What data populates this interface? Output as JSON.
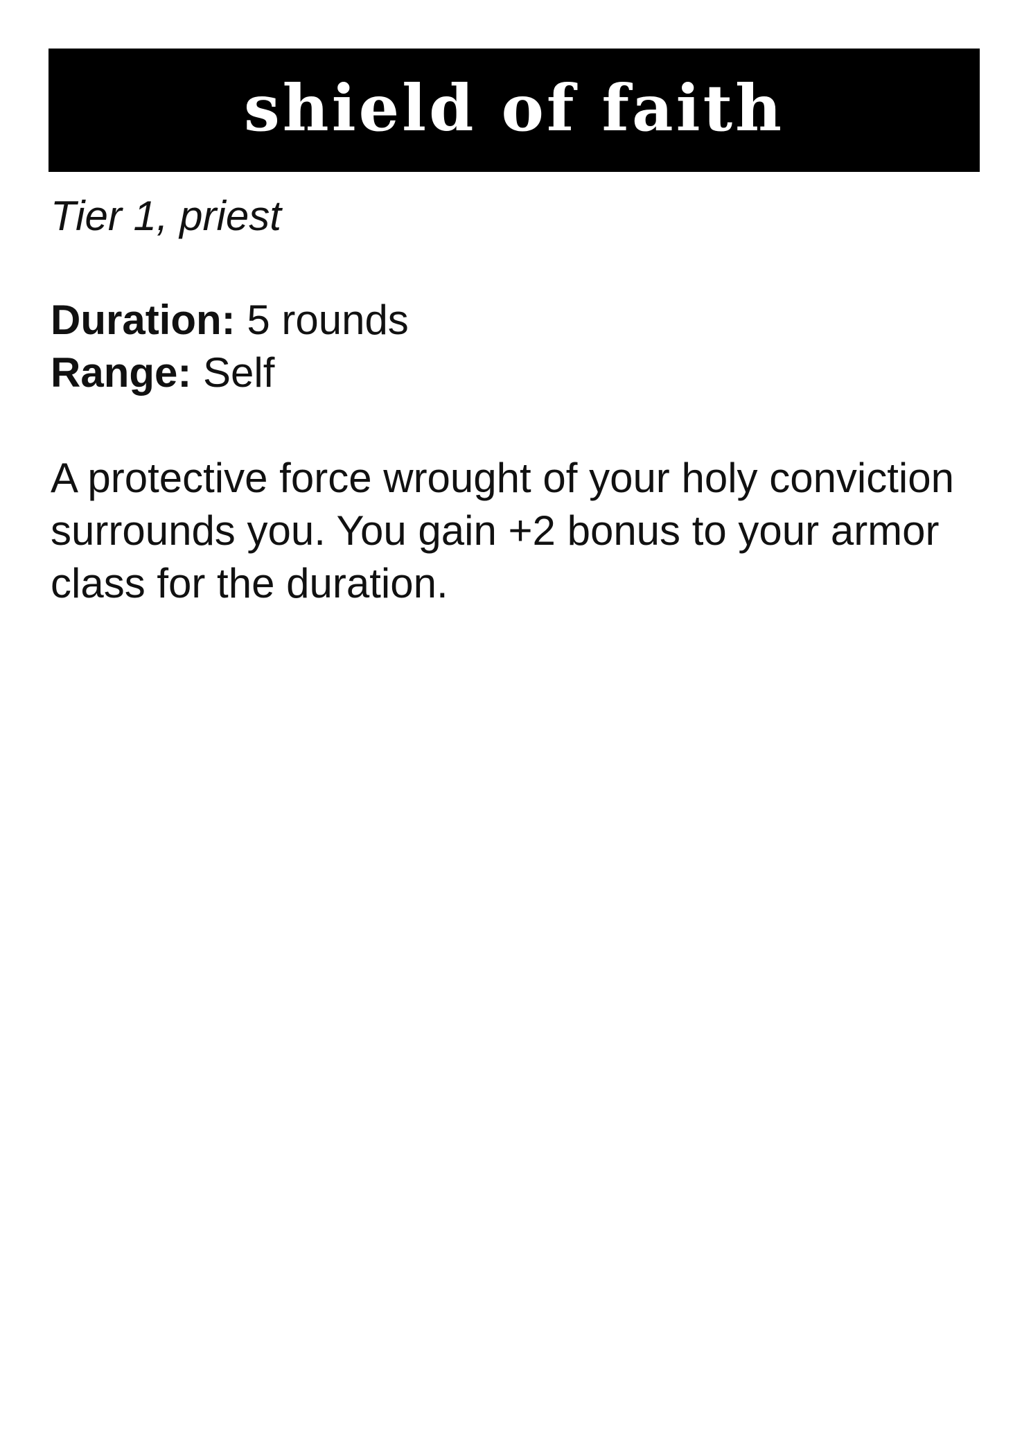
{
  "card": {
    "title": "shield of faith",
    "tier_line": "Tier 1, priest",
    "stats": {
      "duration_label": "Duration:",
      "duration_value": "5 rounds",
      "range_label": "Range:",
      "range_value": "Self"
    },
    "description": "A protective force wrought of your holy conviction surrounds you. You gain +2 bonus to your armor class for the duration."
  }
}
